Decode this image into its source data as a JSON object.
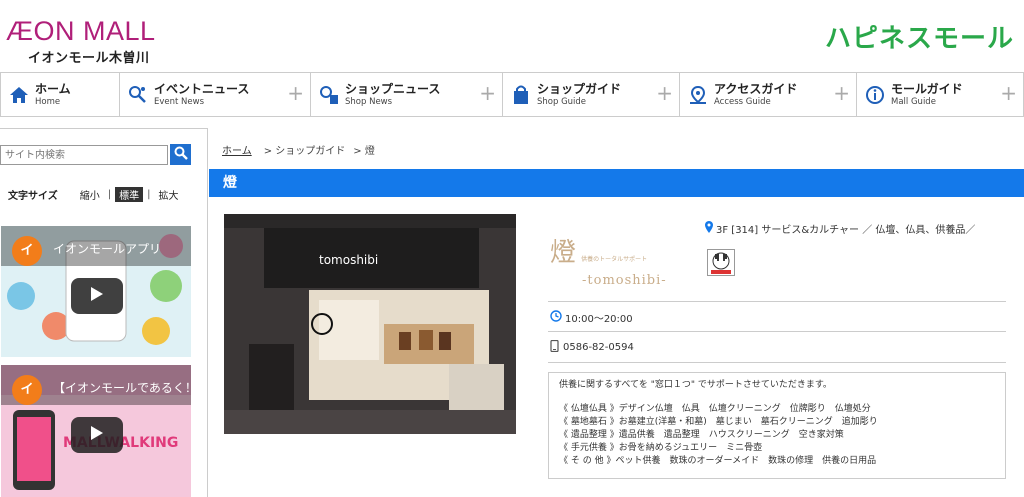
{
  "header": {
    "logo_main": "ÆON MALL",
    "logo_sub": "イオンモール木曽川",
    "happiness_mall": "ハピネスモール"
  },
  "nav": [
    {
      "ja": "ホーム",
      "en": "Home",
      "icon": "home-icon",
      "has_plus": false
    },
    {
      "ja": "イベントニュース",
      "en": "Event News",
      "icon": "event-news-icon",
      "has_plus": true
    },
    {
      "ja": "ショップニュース",
      "en": "Shop News",
      "icon": "shop-news-icon",
      "has_plus": true
    },
    {
      "ja": "ショップガイド",
      "en": "Shop Guide",
      "icon": "shopping-bag-icon",
      "has_plus": true
    },
    {
      "ja": "アクセスガイド",
      "en": "Access Guide",
      "icon": "access-icon",
      "has_plus": true
    },
    {
      "ja": "モールガイド",
      "en": "Mall Guide",
      "icon": "info-icon",
      "has_plus": true
    }
  ],
  "sidebar": {
    "search_placeholder": "サイト内検索",
    "font_size_label": "文字サイズ",
    "font_options": [
      "縮小",
      "標準",
      "拡大"
    ],
    "font_selected": "標準",
    "videos": [
      {
        "avatar": "イ",
        "title": "イオンモールアプリ"
      },
      {
        "avatar": "イ",
        "title": "【イオンモールであるく！"
      }
    ]
  },
  "breadcrumb": {
    "home": "ホーム",
    "items": [
      "> ショップガイド",
      "> 燈"
    ]
  },
  "shop": {
    "name": "燈",
    "logo_kanji": "燈",
    "logo_tagline": "供養のトータルサポート",
    "logo_roma": "-tomoshibi-",
    "storefront_sign": "tomoshibi",
    "location": "3F [314] サービス&カルチャー ／ 仏壇、仏具、供養品／",
    "hours": "10:00～20:00",
    "phone": "0586-82-0594",
    "description_intro": "供養に関するすべてを \"窓口１つ\" でサポートさせていただきます。",
    "description_lines": [
      "《 仏壇仏具 》デザイン仏壇　仏具　仏壇クリーニング　位牌彫り　仏壇処分",
      "《 墓地墓石 》お墓建立(洋墓・和墓)　墓じまい　墓石クリーニング　追加彫り",
      "《 遺品整理 》遺品供養　遺品整理　ハウスクリーニング　空き家対策",
      "《 手元供養 》お骨を納めるジュエリー　ミニ骨壺",
      "《 そ の 他 》ペット供養　数珠のオーダーメイド　数珠の修理　供養の日用品"
    ]
  },
  "colors": {
    "brand": "#b01f79",
    "accent_blue": "#1479ea",
    "happiness_green": "#2aa84a"
  }
}
